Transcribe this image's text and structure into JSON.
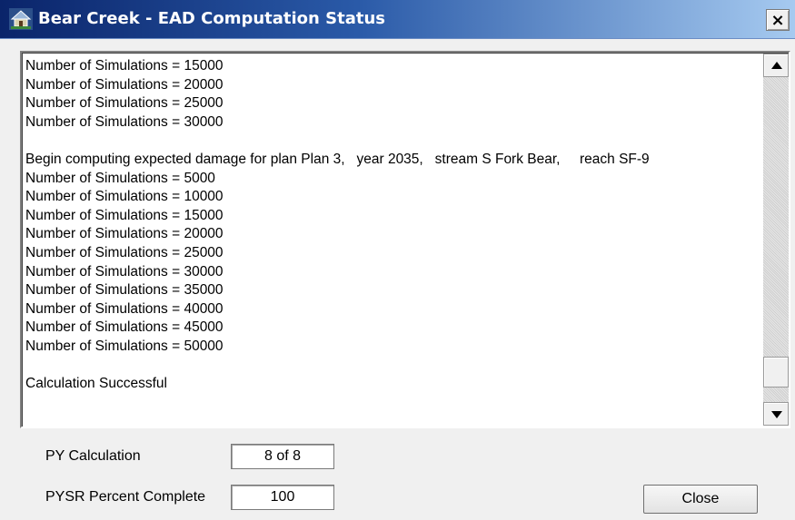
{
  "window": {
    "title": "Bear Creek - EAD Computation Status",
    "close_glyph": "×",
    "app_icon": "house-icon"
  },
  "log": {
    "lines": [
      "Number of Simulations = 15000",
      "Number of Simulations = 20000",
      "Number of Simulations = 25000",
      "Number of Simulations = 30000",
      "",
      "Begin computing expected damage for plan Plan 3,   year 2035,   stream S Fork Bear,     reach SF-9",
      "Number of Simulations = 5000",
      "Number of Simulations = 10000",
      "Number of Simulations = 15000",
      "Number of Simulations = 20000",
      "Number of Simulations = 25000",
      "Number of Simulations = 30000",
      "Number of Simulations = 35000",
      "Number of Simulations = 40000",
      "Number of Simulations = 45000",
      "Number of Simulations = 50000",
      "",
      "Calculation Successful"
    ],
    "scroll_position": 0.95
  },
  "status": {
    "py_calc_label": "PY Calculation",
    "py_calc_value": "8 of 8",
    "pysr_label": "PYSR Percent Complete",
    "pysr_value": "100"
  },
  "buttons": {
    "close_label": "Close"
  }
}
